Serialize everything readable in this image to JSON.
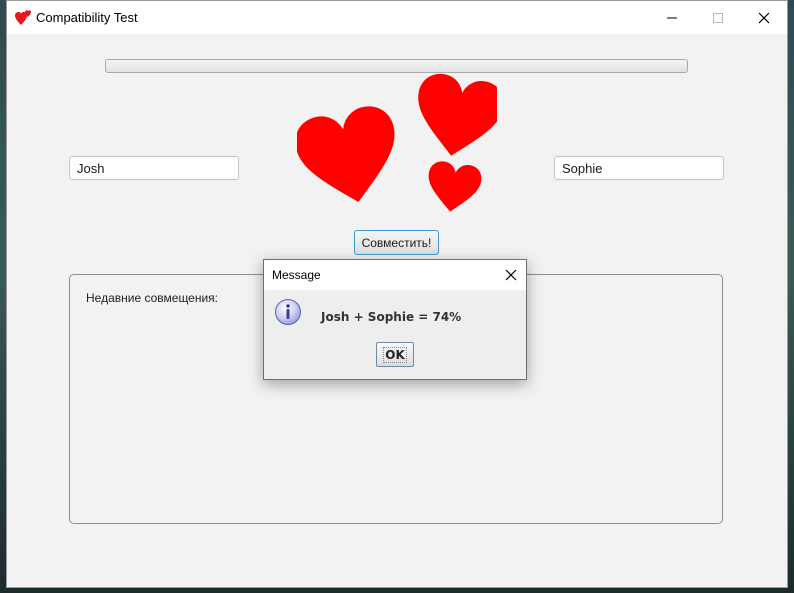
{
  "window": {
    "title": "Compatibility Test",
    "icon": "hearts-icon",
    "controls": {
      "minimize": "minimize-icon",
      "maximize": "maximize-icon",
      "close": "close-icon"
    }
  },
  "progress": {
    "value": 0
  },
  "form": {
    "name_left": "Josh",
    "name_right": "Sophie",
    "match_button": "Совместить!"
  },
  "recent": {
    "label": "Недавние совмещения:"
  },
  "dialog": {
    "title": "Message",
    "icon": "info-icon",
    "message": "Josh + Sophie = 74%",
    "ok_button": "OK"
  },
  "colors": {
    "heart": "#ff0000",
    "button_focus": "#3c9ad6"
  }
}
